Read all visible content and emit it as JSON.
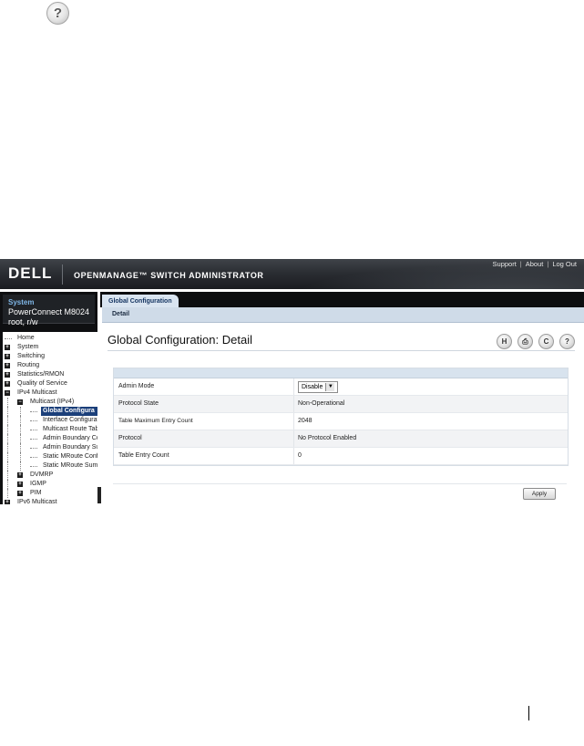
{
  "doc": {
    "help_glyph": "?"
  },
  "app": {
    "logo": "DELL",
    "title": "OPENMANAGE™ SWITCH ADMINISTRATOR",
    "links": [
      "Support",
      "About",
      "Log Out"
    ]
  },
  "system": {
    "label": "System",
    "device": "PowerConnect M8024",
    "user": "root, r/w"
  },
  "tree": [
    {
      "label": "Home",
      "indent": 0,
      "box": "none"
    },
    {
      "label": "System",
      "indent": 0,
      "box": "plus"
    },
    {
      "label": "Switching",
      "indent": 0,
      "box": "plus"
    },
    {
      "label": "Routing",
      "indent": 0,
      "box": "plus"
    },
    {
      "label": "Statistics/RMON",
      "indent": 0,
      "box": "plus"
    },
    {
      "label": "Quality of Service",
      "indent": 0,
      "box": "plus"
    },
    {
      "label": "IPv4 Multicast",
      "indent": 0,
      "box": "minus"
    },
    {
      "label": "Multicast (IPv4)",
      "indent": 1,
      "box": "minus"
    },
    {
      "label": "Global Configura",
      "indent": 2,
      "box": "none",
      "selected": true
    },
    {
      "label": "Interface Configurati",
      "indent": 2,
      "box": "none"
    },
    {
      "label": "Multicast Route Tab",
      "indent": 2,
      "box": "none"
    },
    {
      "label": "Admin Boundary Co",
      "indent": 2,
      "box": "none"
    },
    {
      "label": "Admin Boundary Su",
      "indent": 2,
      "box": "none"
    },
    {
      "label": "Static MRoute Confi",
      "indent": 2,
      "box": "none"
    },
    {
      "label": "Static MRoute Summ",
      "indent": 2,
      "box": "none"
    },
    {
      "label": "DVMRP",
      "indent": 1,
      "box": "plus"
    },
    {
      "label": "IGMP",
      "indent": 1,
      "box": "plus"
    },
    {
      "label": "PIM",
      "indent": 1,
      "box": "plus"
    },
    {
      "label": "IPv6 Multicast",
      "indent": 0,
      "box": "plus"
    }
  ],
  "tab": {
    "label": "Global Configuration",
    "sub_label": "Detail"
  },
  "page": {
    "title": "Global Configuration: Detail"
  },
  "tools": [
    {
      "name": "save-icon",
      "glyph": "H"
    },
    {
      "name": "print-icon",
      "glyph": "⎙"
    },
    {
      "name": "refresh-icon",
      "glyph": "C"
    },
    {
      "name": "help-icon",
      "glyph": "?"
    }
  ],
  "form": {
    "admin_mode_label": "Admin Mode",
    "admin_mode_value": "Disable",
    "protocol_state_label": "Protocol State",
    "protocol_state_value": "Non-Operational",
    "table_max_label": "Table Maximum Entry Count",
    "table_max_value": "2048",
    "protocol_label": "Protocol",
    "protocol_value": "No Protocol Enabled",
    "table_entry_label": "Table Entry Count",
    "table_entry_value": "0"
  },
  "buttons": {
    "apply": "Apply"
  }
}
